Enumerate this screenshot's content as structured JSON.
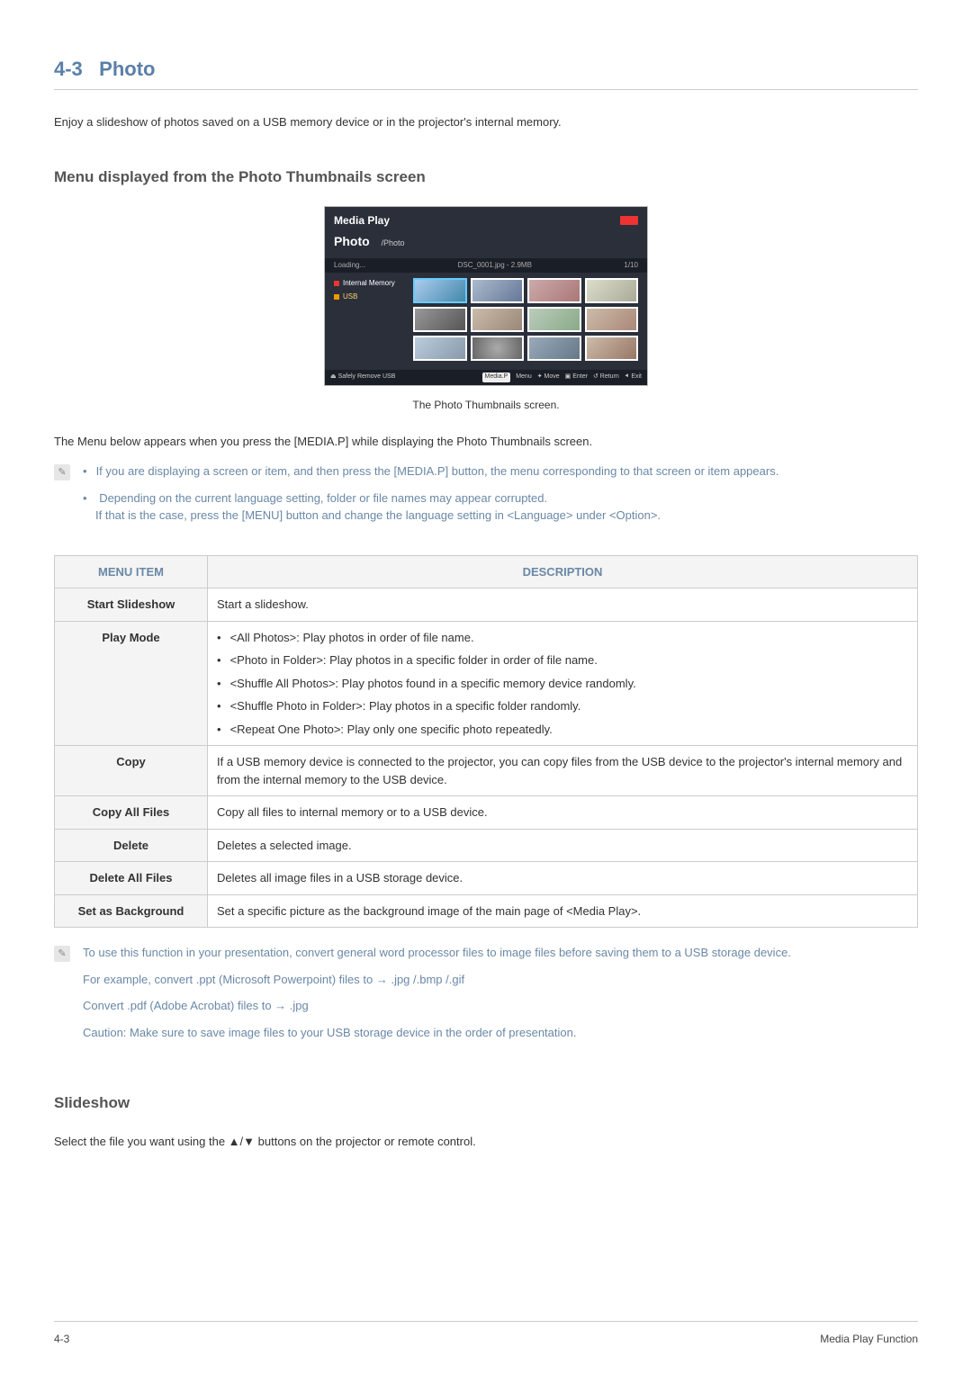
{
  "section_number": "4-3",
  "section_title": "Photo",
  "intro": "Enjoy a slideshow of photos saved on a USB memory device or in the projector's internal memory.",
  "subheadings": {
    "menu_from_thumbnails": "Menu displayed from the Photo Thumbnails screen",
    "slideshow": "Slideshow"
  },
  "screenshot": {
    "app_title": "Media Play",
    "tab_label": "Photo",
    "breadcrumb": "/Photo",
    "status_loading": "Loading...",
    "file_info": "DSC_0001.jpg - 2.9MB",
    "counter": "1/10",
    "side_internal": "Internal Memory",
    "side_usb": "USB",
    "hints_safely_remove": "Safely Remove USB",
    "hints_mediap": "Media.P",
    "hints_menu": "Menu",
    "hints_move": "Move",
    "hints_enter": "Enter",
    "hints_return": "Return",
    "hints_exit": "Exit"
  },
  "caption": "The Photo Thumbnails screen.",
  "after_caption": "The Menu below appears when you press the [MEDIA.P] while displaying the Photo Thumbnails screen.",
  "notes": {
    "n1": "If you are displaying a screen or item, and then press the [MEDIA.P] button, the menu corresponding to that screen or item appears.",
    "n2a": "Depending on the current language setting, folder or file names may appear corrupted.",
    "n2b": "If that is the case, press the [MENU] button and change the language setting in <Language> under <Option>."
  },
  "table_headers": {
    "menu_item": "MENU ITEM",
    "description": "DESCRIPTION"
  },
  "rows": {
    "start_slideshow": {
      "label": "Start Slideshow",
      "desc": "Start a slideshow."
    },
    "play_mode": {
      "label": "Play Mode",
      "items": [
        "<All Photos>: Play photos in order of file name.",
        "<Photo in Folder>: Play photos in a specific folder in order of file name.",
        "<Shuffle All Photos>: Play photos found in a specific memory device randomly.",
        "<Shuffle Photo in Folder>: Play photos in a specific folder randomly.",
        "<Repeat One Photo>: Play only one specific photo repeatedly."
      ]
    },
    "copy": {
      "label": "Copy",
      "desc": "If a USB memory device is connected to the projector, you can copy files from the USB device to the projector's internal memory and from the internal memory to the USB device."
    },
    "copy_all": {
      "label": "Copy All Files",
      "desc": "Copy all files to internal memory or to a USB device."
    },
    "delete": {
      "label": "Delete",
      "desc": "Deletes a selected image."
    },
    "delete_all": {
      "label": "Delete All Files",
      "desc": "Deletes all image files in a USB storage device."
    },
    "set_bg": {
      "label": "Set as Background",
      "desc": "Set a specific picture as the background image of the main page of <Media Play>."
    }
  },
  "info": {
    "p1": "To use this function in your presentation, convert general word processor files to image files before saving them to a USB storage device.",
    "p2": "For example, convert .ppt (Microsoft Powerpoint) files to → .jpg /.bmp /.gif",
    "p3": "Convert .pdf (Adobe Acrobat) files to → .jpg",
    "p4": "Caution: Make sure to save image files to your USB storage device in the order of presentation."
  },
  "slideshow_body": "Select the file you want using the ▲/▼ buttons on the projector or remote control.",
  "footer": {
    "left": "4-3",
    "right": "Media Play Function"
  }
}
